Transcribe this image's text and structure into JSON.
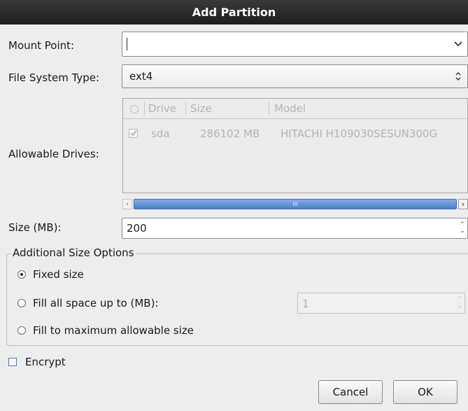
{
  "dialog": {
    "title": "Add Partition"
  },
  "mount_point": {
    "label": "Mount Point:",
    "value": ""
  },
  "fs_type": {
    "label": "File System Type:",
    "value": "ext4"
  },
  "drives": {
    "label": "Allowable Drives:",
    "columns": [
      "Drive",
      "Size",
      "Model"
    ],
    "rows": [
      {
        "checked": true,
        "drive": "sda",
        "size": "286102 MB",
        "model": "HITACHI H109030SESUN300G"
      }
    ],
    "scroll_grip": "III"
  },
  "size": {
    "label": "Size (MB):",
    "value": "200"
  },
  "size_options": {
    "legend": "Additional Size Options",
    "fixed": {
      "label": "Fixed size",
      "selected": true
    },
    "fill_upto": {
      "label": "Fill all space up to (MB):",
      "selected": false,
      "value": "1"
    },
    "fill_max": {
      "label": "Fill to maximum allowable size",
      "selected": false
    }
  },
  "encrypt": {
    "label": "Encrypt",
    "checked": false
  },
  "buttons": {
    "cancel": "Cancel",
    "ok": "OK"
  },
  "colors": {
    "titlebar": "#262626",
    "scroll_thumb": "#5b8bd0",
    "background": "#ededed"
  }
}
